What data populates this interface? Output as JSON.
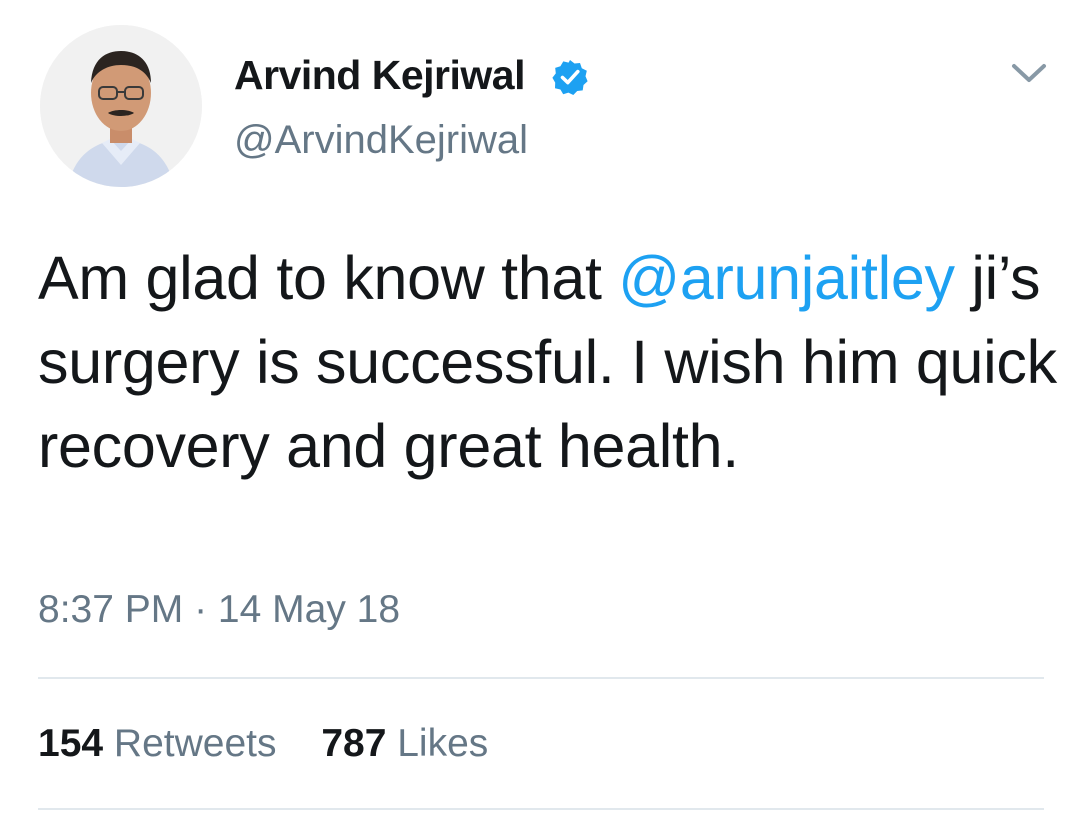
{
  "author": {
    "name": "Arvind Kejriwal",
    "handle": "@ArvindKejriwal",
    "verified": true
  },
  "tweet": {
    "text_before": "Am glad to know that ",
    "mention": "@arunjaitley",
    "text_after": " ji’s surgery is successful. I wish him quick recovery and great health."
  },
  "meta": {
    "time": "8:37 PM",
    "separator": " · ",
    "date": "14 May 18"
  },
  "stats": {
    "retweets_count": "154",
    "retweets_label": " Retweets",
    "likes_count": "787",
    "likes_label": " Likes"
  },
  "icons": {
    "verified": "verified-badge-icon",
    "menu": "chevron-down-icon"
  },
  "colors": {
    "link": "#1da1f2",
    "text": "#14171a",
    "secondary": "#657786",
    "divider": "#e1e8ed",
    "verified": "#1da1f2"
  }
}
